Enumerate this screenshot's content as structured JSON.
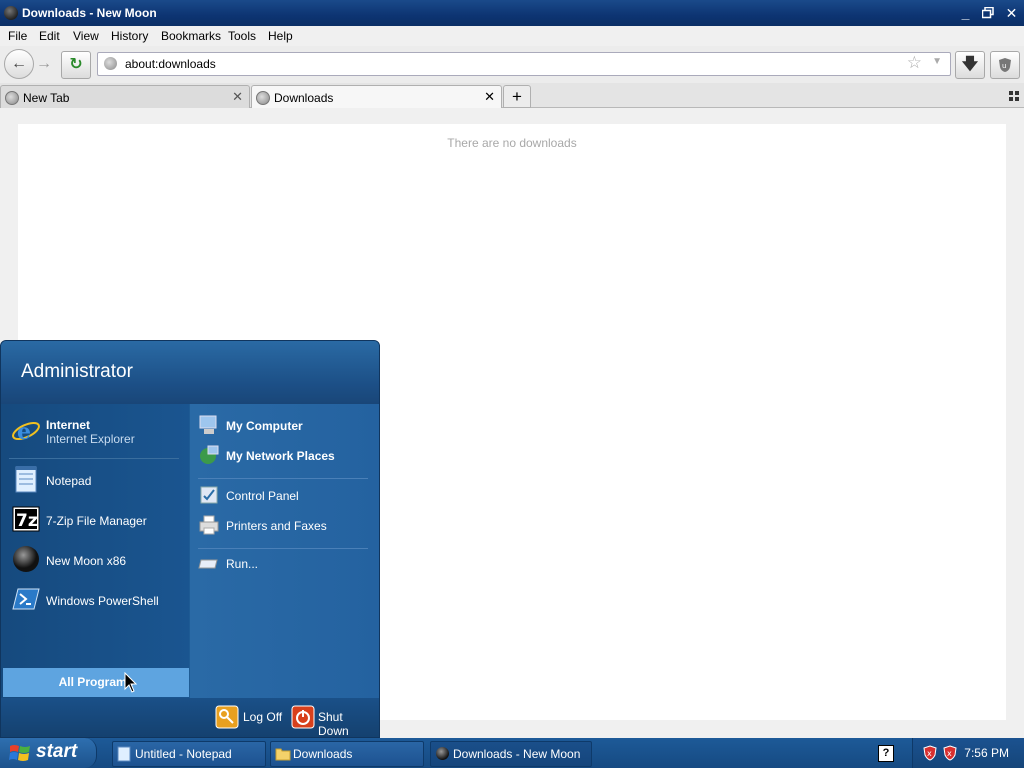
{
  "window": {
    "title": "Downloads - New Moon"
  },
  "menu": [
    "File",
    "Edit",
    "View",
    "History",
    "Bookmarks",
    "Tools",
    "Help"
  ],
  "navbar": {
    "url": "about:downloads"
  },
  "tabs": [
    {
      "label": "New Tab",
      "active": false
    },
    {
      "label": "Downloads",
      "active": true
    }
  ],
  "content": {
    "empty_message": "There are no downloads"
  },
  "start_menu": {
    "user": "Administrator",
    "pinned": [
      {
        "title": "Internet",
        "subtitle": "Internet Explorer"
      }
    ],
    "recent": [
      {
        "label": "Notepad"
      },
      {
        "label": "7-Zip File Manager"
      },
      {
        "label": "New Moon x86"
      },
      {
        "label": "Windows PowerShell"
      }
    ],
    "all_programs": "All Programs",
    "right": [
      {
        "label": "My Computer"
      },
      {
        "label": "My Network Places"
      },
      {
        "label": "Control Panel"
      },
      {
        "label": "Printers and Faxes"
      },
      {
        "label": "Run..."
      }
    ],
    "log_off": "Log Off",
    "shut_down": "Shut Down"
  },
  "taskbar": {
    "start": "start",
    "items": [
      {
        "label": "Untitled - Notepad"
      },
      {
        "label": "Downloads"
      },
      {
        "label": "Downloads - New Moon"
      }
    ],
    "clock": "7:56 PM"
  },
  "colors": {
    "accent": "#1e5b94",
    "title_bar": "#0d3472",
    "all_programs": "#5ea4e0"
  }
}
